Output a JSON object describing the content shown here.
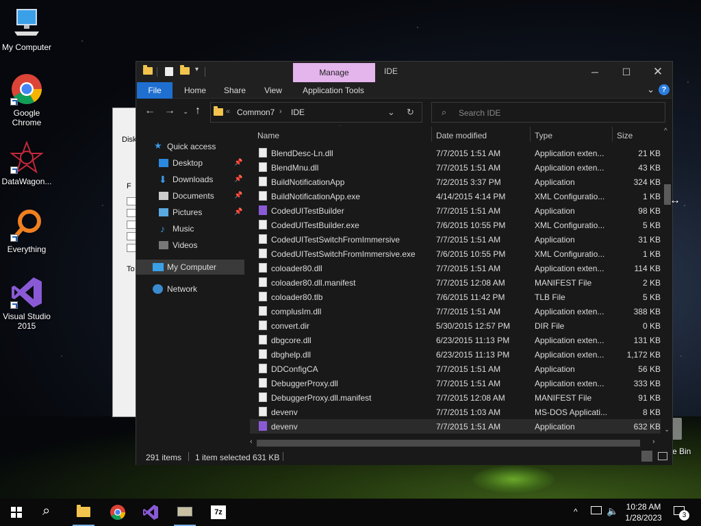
{
  "desktop": {
    "icons": [
      {
        "label": "My Computer",
        "icon": "computer-icon"
      },
      {
        "label": "Google Chrome",
        "icon": "chrome-icon"
      },
      {
        "label": "DataWagon...",
        "icon": "datawagon-icon"
      },
      {
        "label": "Everything",
        "icon": "everything-icon"
      },
      {
        "label": "Visual Studio 2015",
        "icon": "visual-studio-icon"
      }
    ],
    "recycle_bin_partial": "e Bin"
  },
  "explorer": {
    "manage_tab": "Manage",
    "window_title": "IDE",
    "ribbon_tabs": [
      "File",
      "Home",
      "Share",
      "View",
      "Application Tools"
    ],
    "breadcrumb": [
      "Common7",
      "IDE"
    ],
    "search_placeholder": "Search IDE",
    "nav": {
      "quick_access": "Quick access",
      "desktop": "Desktop",
      "downloads": "Downloads",
      "documents": "Documents",
      "pictures": "Pictures",
      "music": "Music",
      "videos": "Videos",
      "my_computer": "My Computer",
      "network": "Network"
    },
    "columns": {
      "name": "Name",
      "date": "Date modified",
      "type": "Type",
      "size": "Size"
    },
    "files": [
      {
        "name": "BlendDesc-Ln.dll",
        "date": "7/7/2015 1:51 AM",
        "type": "Application exten...",
        "size": "21 KB"
      },
      {
        "name": "BlendMnu.dll",
        "date": "7/7/2015 1:51 AM",
        "type": "Application exten...",
        "size": "43 KB"
      },
      {
        "name": "BuildNotificationApp",
        "date": "7/2/2015 3:37 PM",
        "type": "Application",
        "size": "324 KB"
      },
      {
        "name": "BuildNotificationApp.exe",
        "date": "4/14/2015 4:14 PM",
        "type": "XML Configuratio...",
        "size": "1 KB"
      },
      {
        "name": "CodedUITestBuilder",
        "date": "7/7/2015 1:51 AM",
        "type": "Application",
        "size": "98 KB"
      },
      {
        "name": "CodedUITestBuilder.exe",
        "date": "7/6/2015 10:55 PM",
        "type": "XML Configuratio...",
        "size": "5 KB"
      },
      {
        "name": "CodedUITestSwitchFromImmersive",
        "date": "7/7/2015 1:51 AM",
        "type": "Application",
        "size": "31 KB"
      },
      {
        "name": "CodedUITestSwitchFromImmersive.exe",
        "date": "7/6/2015 10:55 PM",
        "type": "XML Configuratio...",
        "size": "1 KB"
      },
      {
        "name": "coloader80.dll",
        "date": "7/7/2015 1:51 AM",
        "type": "Application exten...",
        "size": "114 KB"
      },
      {
        "name": "coloader80.dll.manifest",
        "date": "7/7/2015 12:08 AM",
        "type": "MANIFEST File",
        "size": "2 KB"
      },
      {
        "name": "coloader80.tlb",
        "date": "7/6/2015 11:42 PM",
        "type": "TLB File",
        "size": "5 KB"
      },
      {
        "name": "complusIm.dll",
        "date": "7/7/2015 1:51 AM",
        "type": "Application exten...",
        "size": "388 KB"
      },
      {
        "name": "convert.dir",
        "date": "5/30/2015 12:57 PM",
        "type": "DIR File",
        "size": "0 KB"
      },
      {
        "name": "dbgcore.dll",
        "date": "6/23/2015 11:13 PM",
        "type": "Application exten...",
        "size": "131 KB"
      },
      {
        "name": "dbghelp.dll",
        "date": "6/23/2015 11:13 PM",
        "type": "Application exten...",
        "size": "1,172 KB"
      },
      {
        "name": "DDConfigCA",
        "date": "7/7/2015 1:51 AM",
        "type": "Application",
        "size": "56 KB"
      },
      {
        "name": "DebuggerProxy.dll",
        "date": "7/7/2015 1:51 AM",
        "type": "Application exten...",
        "size": "333 KB"
      },
      {
        "name": "DebuggerProxy.dll.manifest",
        "date": "7/7/2015 12:08 AM",
        "type": "MANIFEST File",
        "size": "91 KB"
      },
      {
        "name": "devenv",
        "date": "7/7/2015 1:03 AM",
        "type": "MS-DOS Applicati...",
        "size": "8 KB"
      },
      {
        "name": "devenv",
        "date": "7/7/2015 1:51 AM",
        "type": "Application",
        "size": "632 KB"
      }
    ],
    "status": {
      "items": "291 items",
      "selected": "1 item selected  631 KB"
    }
  },
  "bgwindow": {
    "label_disk": "Disk",
    "label_f": "F",
    "label_to": "To"
  },
  "taskbar": {
    "time": "10:28 AM",
    "date": "1/28/2023",
    "notification_count": "3"
  }
}
